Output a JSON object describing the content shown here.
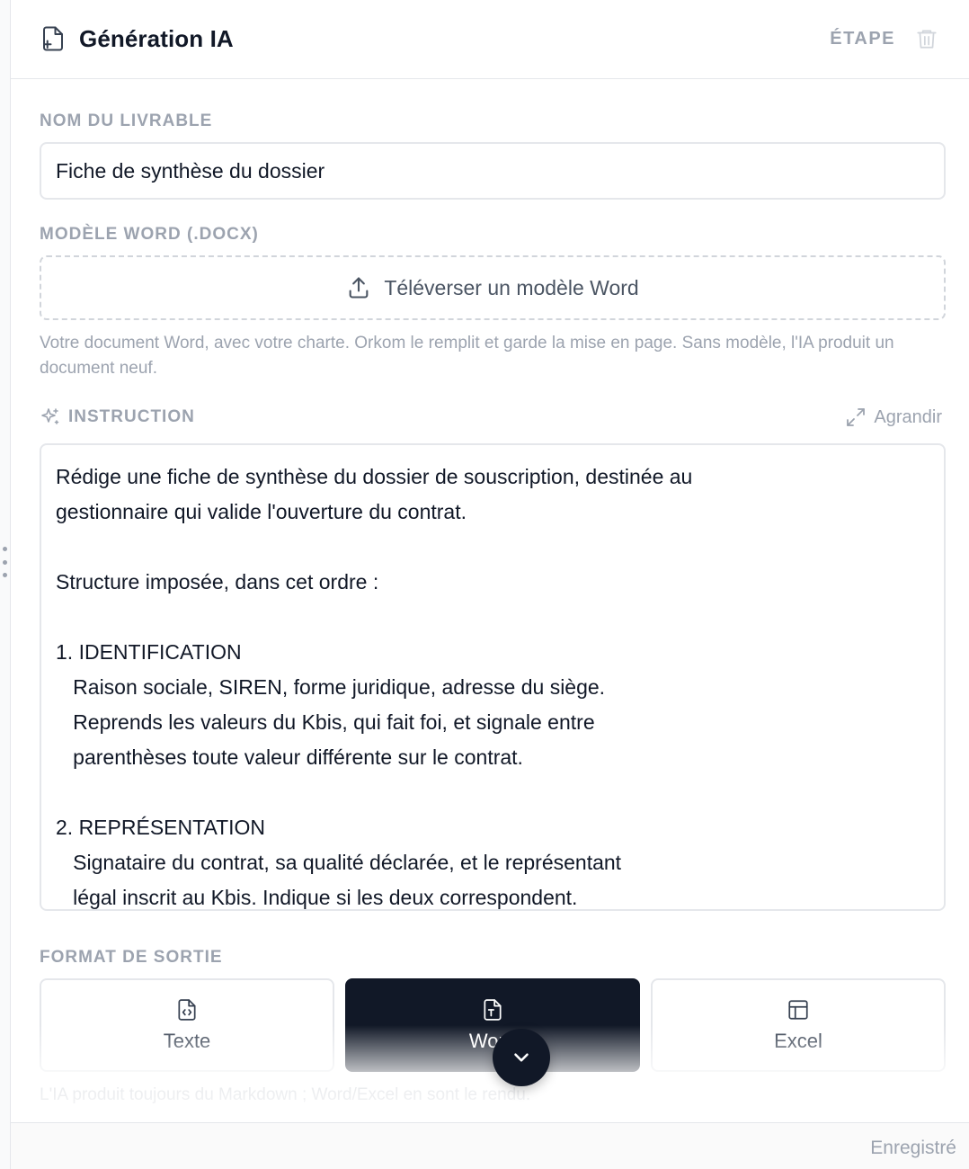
{
  "header": {
    "title": "Génération IA",
    "step_label": "ÉTAPE",
    "icons": {
      "document": "file-plus-icon",
      "delete": "trash-icon"
    }
  },
  "deliverable": {
    "label": "NOM DU LIVRABLE",
    "value": "Fiche de synthèse du dossier"
  },
  "template": {
    "label": "MODÈLE WORD (.DOCX)",
    "upload_label": "Téléverser un modèle Word",
    "help_text": "Votre document Word, avec votre charte. Orkom le remplit et garde la mise en page. Sans modèle, l'IA produit un document neuf."
  },
  "instruction": {
    "label": "INSTRUCTION",
    "expand_label": "Agrandir",
    "value": "Rédige une fiche de synthèse du dossier de souscription, destinée au\ngestionnaire qui valide l'ouverture du contrat.\n\nStructure imposée, dans cet ordre :\n\n1. IDENTIFICATION\n   Raison sociale, SIREN, forme juridique, adresse du siège.\n   Reprends les valeurs du Kbis, qui fait foi, et signale entre\n   parenthèses toute valeur différente sur le contrat.\n\n2. REPRÉSENTATION\n   Signataire du contrat, sa qualité déclarée, et le représentant\n   légal inscrit au Kbis. Indique si les deux correspondent."
  },
  "output_format": {
    "label": "FORMAT DE SORTIE",
    "options": [
      {
        "label": "Texte",
        "icon": "file-code-icon",
        "selected": false
      },
      {
        "label": "Word",
        "icon": "file-type-icon",
        "selected": true
      },
      {
        "label": "Excel",
        "icon": "table-icon",
        "selected": false
      }
    ],
    "footnote": "L'IA produit toujours du Markdown ; Word/Excel en sont le rendu."
  },
  "footer": {
    "status": "Enregistré"
  },
  "colors": {
    "accent_dark": "#111827",
    "muted_text": "#9ca3af",
    "border": "#e5e7eb"
  }
}
